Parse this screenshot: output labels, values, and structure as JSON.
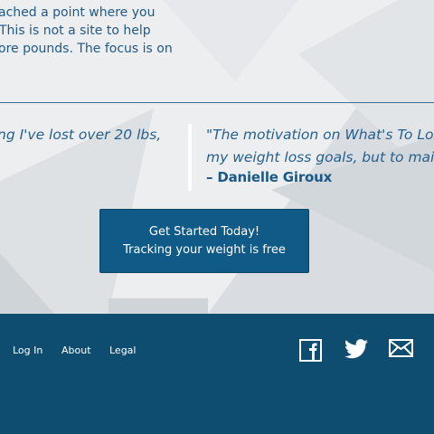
{
  "intro": {
    "line1": "ached a point where you",
    "line2": "This is not a site to help",
    "line3": "ore pounds. The focus is on"
  },
  "testimonials": {
    "left_quote": "ng I've lost over 20 lbs,",
    "right_quote_line1": "\"The motivation on What's To Lose is e",
    "right_quote_line2": "my weight loss goals, but to maintain",
    "right_author": "– Danielle Giroux"
  },
  "cta": {
    "line1": "Get Started Today!",
    "line2": "Tracking your weight is free"
  },
  "footer": {
    "links": [
      "Log In",
      "About",
      "Legal"
    ],
    "social": [
      "facebook-icon",
      "twitter-icon",
      "mail-icon"
    ]
  },
  "colors": {
    "footer_bg": "#0f4d70",
    "button_bg": "#0f5a87",
    "text_blue": "#28608c",
    "hero_bg": "#eceef0"
  }
}
